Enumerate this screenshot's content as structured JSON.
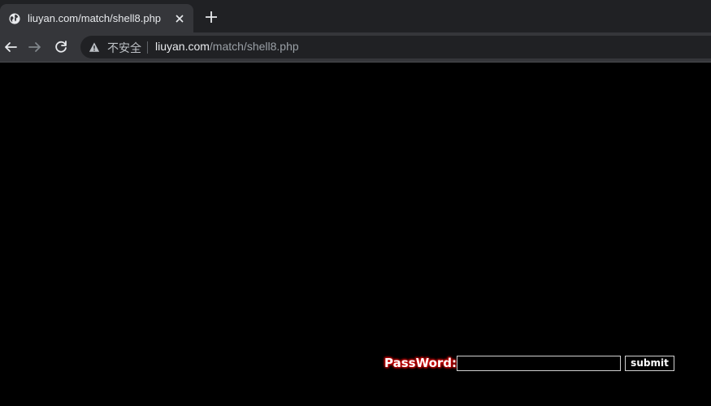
{
  "tab": {
    "title": "liuyan.com/match/shell8.php",
    "favicon": "globe-icon",
    "close_icon": "close-icon"
  },
  "toolbar": {
    "back_icon": "back-arrow-icon",
    "forward_icon": "forward-arrow-icon",
    "reload_icon": "reload-icon",
    "new_tab_icon": "plus-icon"
  },
  "omnibox": {
    "security_icon": "warning-icon",
    "security_label": "不安全",
    "url_host": "liuyan.com",
    "url_path": "/match/shell8.php"
  },
  "form": {
    "label": "PassWord:",
    "password_value": "",
    "submit_label": "submit"
  },
  "colors": {
    "page_background": "#000000",
    "label_glow": "#cc0000",
    "chrome_dark": "#202124",
    "chrome_tab": "#35363a"
  }
}
